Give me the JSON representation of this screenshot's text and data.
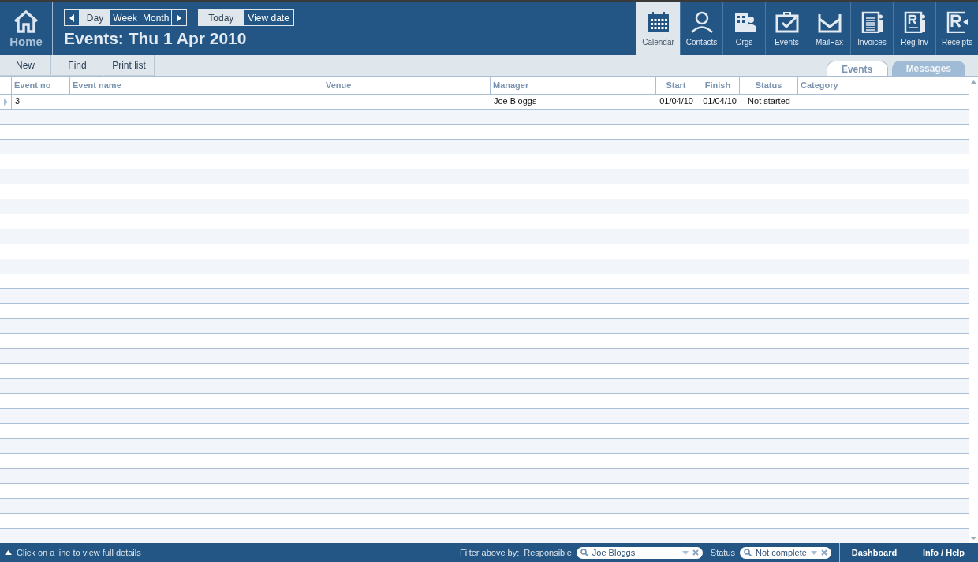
{
  "home": {
    "label": "Home"
  },
  "date_nav": {
    "periods": [
      {
        "label": "Day",
        "selected": true
      },
      {
        "label": "Week",
        "selected": false
      },
      {
        "label": "Month",
        "selected": false
      }
    ],
    "actions": [
      {
        "label": "Today",
        "selected": true
      },
      {
        "label": "View date",
        "selected": false
      }
    ]
  },
  "title": "Events: Thu 1 Apr 2010",
  "modules": [
    {
      "label": "Calendar",
      "kind": "calendar",
      "selected": true
    },
    {
      "label": "Contacts",
      "kind": "person",
      "selected": false
    },
    {
      "label": "Orgs",
      "kind": "building",
      "selected": false
    },
    {
      "label": "Events",
      "kind": "briefcase",
      "selected": false
    },
    {
      "label": "MailFax",
      "kind": "mail",
      "selected": false
    },
    {
      "label": "Invoices",
      "kind": "document",
      "selected": false
    },
    {
      "label": "Reg Inv",
      "kind": "reg",
      "selected": false
    },
    {
      "label": "Receipts",
      "kind": "receipt",
      "selected": false
    }
  ],
  "toolbar": [
    "New",
    "Find",
    "Print list"
  ],
  "tabs": [
    {
      "label": "Events",
      "selected": true
    },
    {
      "label": "Messages",
      "selected": false
    }
  ],
  "table": {
    "columns": [
      "Event no",
      "Event name",
      "Venue",
      "Manager",
      "Start",
      "Finish",
      "Status",
      "Category"
    ],
    "rows": [
      [
        "3",
        "",
        "",
        "Joe Bloggs",
        "01/04/10",
        "01/04/10",
        "Not started",
        ""
      ]
    ]
  },
  "status_bar": {
    "hint": "Click on a line to view full details",
    "filter_label": "Filter above by:",
    "filters": [
      {
        "label": "Responsible",
        "value": "Joe Bloggs"
      },
      {
        "label": "Status",
        "value": "Not complete"
      }
    ],
    "buttons": [
      "Dashboard",
      "Info / Help"
    ]
  }
}
